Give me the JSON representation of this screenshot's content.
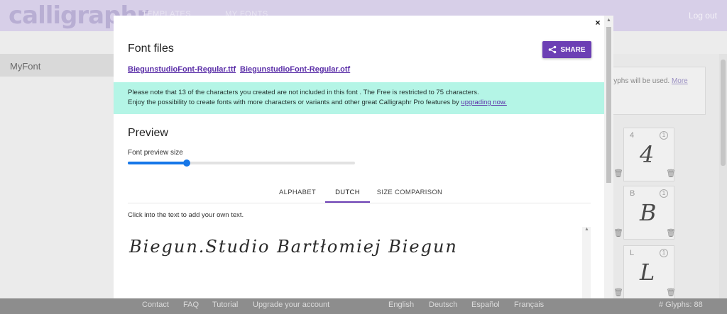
{
  "app": {
    "logo": "calligraphr",
    "nav": [
      "TEMPLATES",
      "MY FONTS"
    ],
    "logout": "Log out",
    "sidebar": {
      "font_name": "MyFont"
    },
    "bg_card": {
      "text": "lyphs will be used.",
      "more": "More"
    },
    "glyph_cells": [
      {
        "label": "4",
        "count": "1",
        "glyph": "4"
      },
      {
        "label": "B",
        "count": "1",
        "glyph": "B"
      },
      {
        "label": "L",
        "count": "1",
        "glyph": "L"
      }
    ],
    "icons": {
      "trash": "trash-icon",
      "share": "share-icon",
      "close": "close-icon"
    }
  },
  "footer": {
    "links": [
      "Contact",
      "FAQ",
      "Tutorial",
      "Upgrade your account"
    ],
    "languages": [
      "English",
      "Deutsch",
      "Español",
      "Français"
    ],
    "glyph_count": "# Glyphs: 88"
  },
  "modal": {
    "close": "×",
    "font_files_title": "Font files",
    "share_label": "SHARE",
    "files": [
      "BiegunstudioFont-Regular.ttf",
      "BiegunstudioFont-Regular.otf"
    ],
    "notice": {
      "line1": "Please note that 13 of the characters you created are not included in this font . The Free is restricted to 75 characters.",
      "line2": "Enjoy the possibility to create fonts with more characters or variants and other great Calligraphr Pro features by",
      "upgrade_link": "upgrading now."
    },
    "preview_title": "Preview",
    "preview_size_label": "Font preview size",
    "preview_size_fraction": 0.26,
    "tabs": [
      "ALPHABET",
      "DUTCH",
      "SIZE COMPARISON"
    ],
    "active_tab": "DUTCH",
    "hint": "Click into the text to add your own text.",
    "preview_text": "Biegun.Studio Bartłomiej Biegun"
  },
  "colors": {
    "accent": "#6c3fb4",
    "notice_bg": "#b4f5e6",
    "slider": "#1677e8"
  }
}
